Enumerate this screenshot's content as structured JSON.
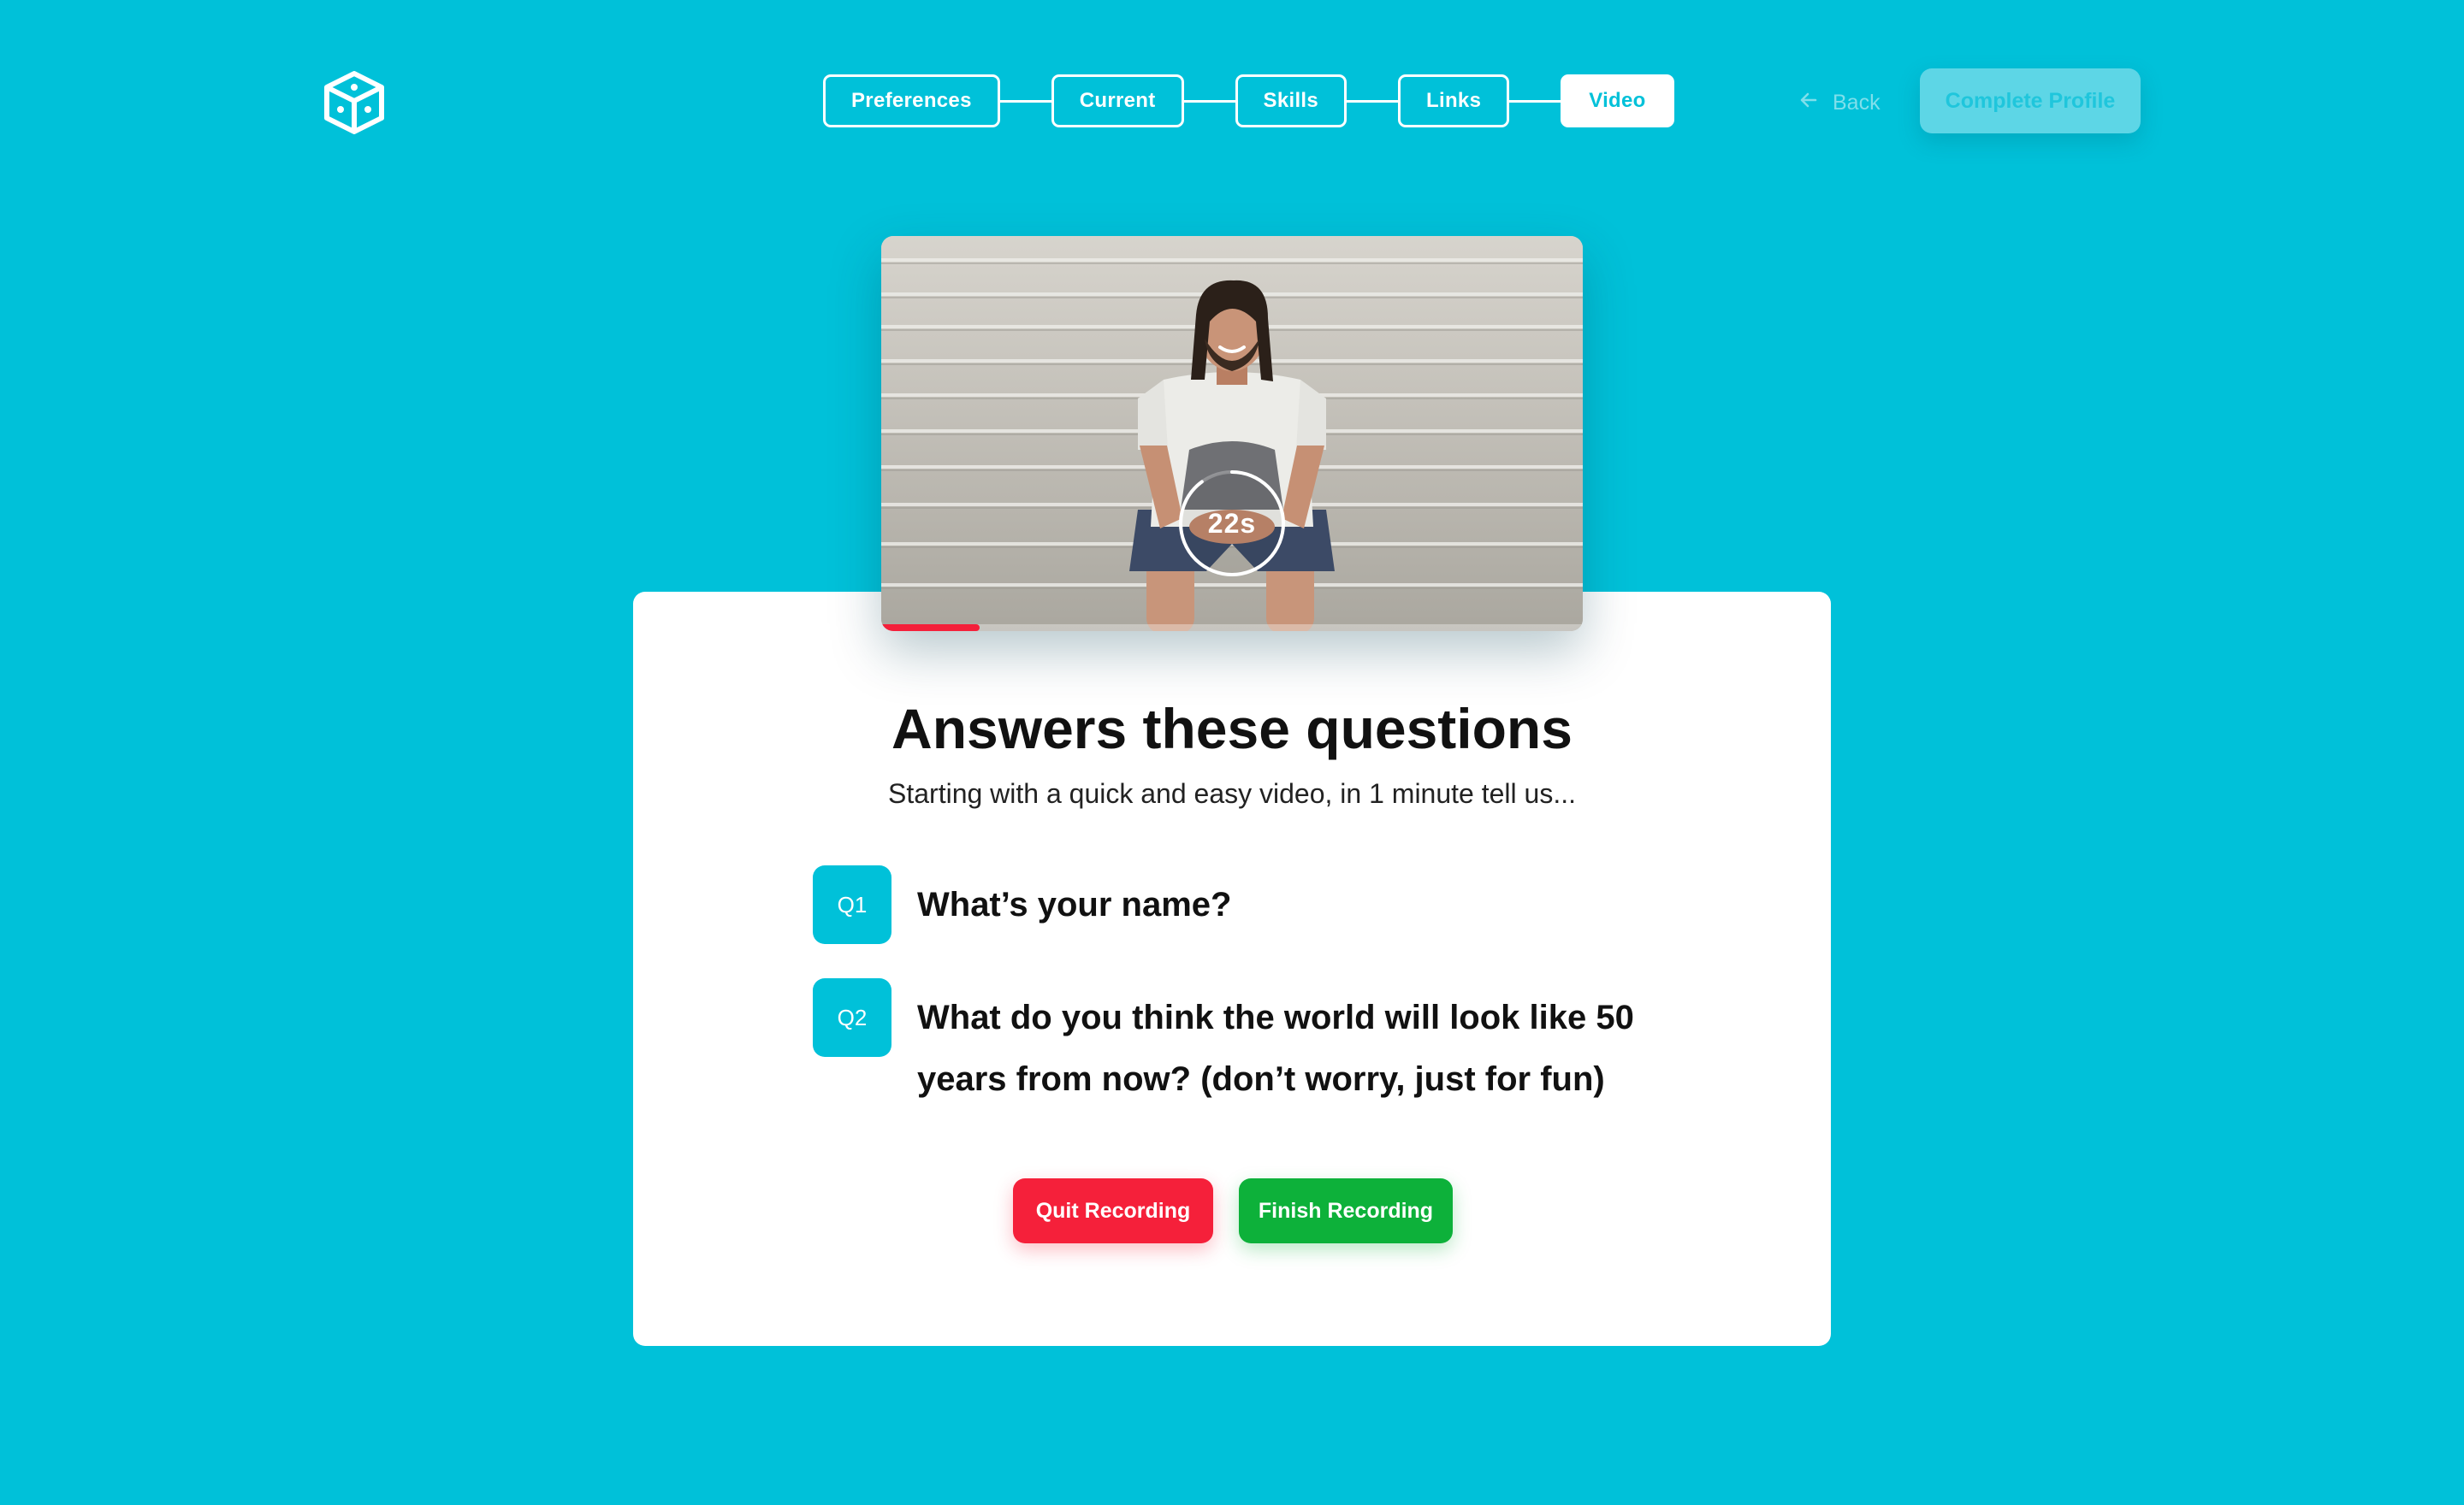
{
  "header": {
    "logo_icon": "cube-icon",
    "steps": [
      {
        "label": "Preferences",
        "active": false
      },
      {
        "label": "Current",
        "active": false
      },
      {
        "label": "Skills",
        "active": false
      },
      {
        "label": "Links",
        "active": false
      },
      {
        "label": "Video",
        "active": true
      }
    ],
    "back_label": "Back",
    "back_icon": "arrow-left-icon",
    "complete_label": "Complete Profile"
  },
  "video": {
    "timer_label": "22s",
    "timer_fraction": 0.9,
    "progress": 0.14
  },
  "card": {
    "title": "Answers these questions",
    "subtitle": "Starting with a quick and easy video, in 1 minute tell us...",
    "questions": [
      {
        "badge": "Q1",
        "text": "What’s your name?"
      },
      {
        "badge": "Q2",
        "text": "What do you think the world will look like 50 years from now? (don’t worry, just for fun)"
      }
    ],
    "quit_label": "Quit Recording",
    "finish_label": "Finish Recording"
  },
  "colors": {
    "background": "#00c1d9",
    "accent": "#00c1d9",
    "danger": "#f5203a",
    "success": "#0db13a",
    "card": "#ffffff"
  }
}
